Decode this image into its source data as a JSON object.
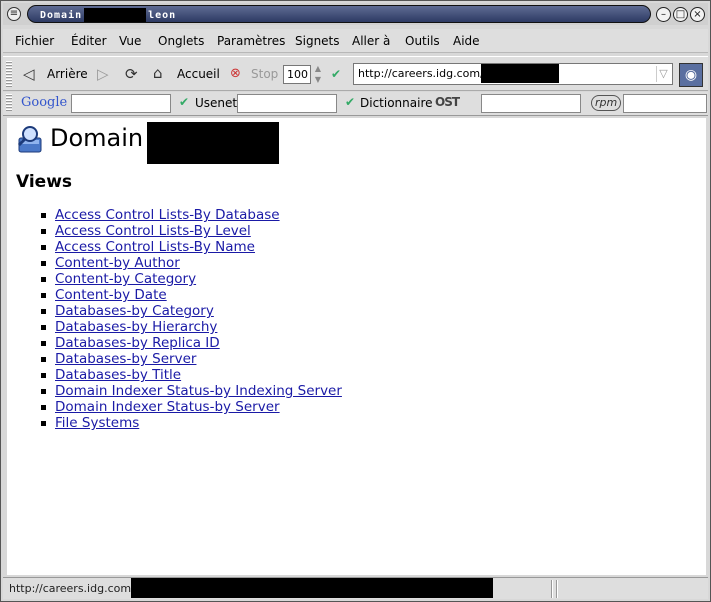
{
  "window": {
    "title_prefix": "Domain",
    "title_suffix": "leon"
  },
  "menubar": {
    "items": [
      "Fichier",
      "Éditer",
      "Vue",
      "Onglets",
      "Paramètres",
      "Signets",
      "Aller à",
      "Outils",
      "Aide"
    ]
  },
  "nav": {
    "back_label": "Arrière",
    "home_label": "Accueil",
    "stop_label": "Stop",
    "zoom_value": "100",
    "url": "http://careers.idg.com/"
  },
  "searchbar": {
    "google_label": "Google",
    "usenet_label": "Usenet",
    "dictionary_label": "Dictionnaire",
    "ost_label": "OST",
    "rpm_label": "rpm"
  },
  "page": {
    "title": "Domain",
    "views_heading": "Views",
    "views": [
      "Access Control Lists-By Database",
      "Access Control Lists-By Level",
      "Access Control Lists-By Name",
      "Content-by Author",
      "Content-by Category",
      "Content-by Date",
      "Databases-by Category",
      "Databases-by Hierarchy",
      "Databases-by Replica ID",
      "Databases-by Server",
      "Databases-by Title",
      "Domain Indexer Status-by Indexing Server",
      "Domain Indexer Status-by Server",
      "File Systems"
    ]
  },
  "status": {
    "text": "http://careers.idg.com/"
  },
  "colors": {
    "link": "#1a1aa6",
    "titlebar": "#2d3a63"
  }
}
